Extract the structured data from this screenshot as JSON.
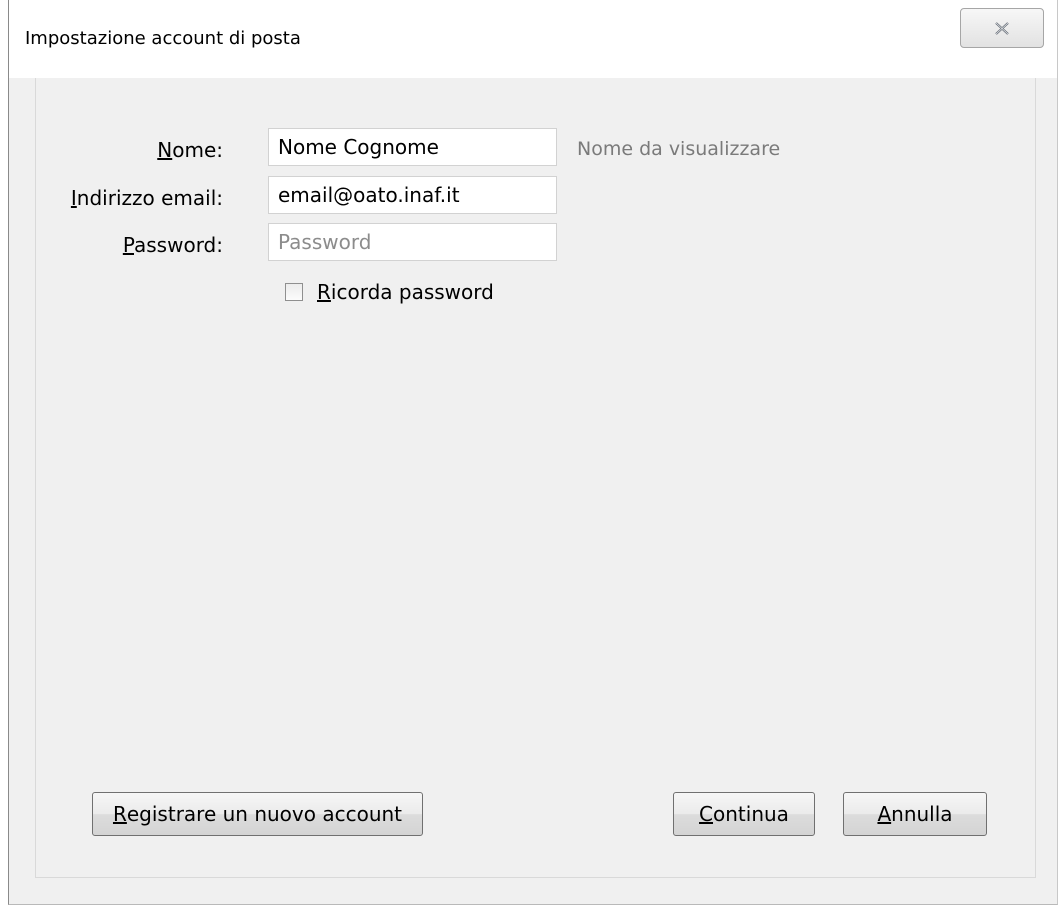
{
  "window": {
    "title": "Impostazione account di posta",
    "close_icon": "close-icon"
  },
  "form": {
    "name": {
      "label_key": "N",
      "label_rest": "ome:",
      "value": "Nome Cognome",
      "hint": "Nome da visualizzare"
    },
    "email": {
      "label_key": "I",
      "label_rest": "ndirizzo email:",
      "value": "email@oato.inaf.it"
    },
    "password": {
      "label_key": "P",
      "label_rest": "assword:",
      "value": "",
      "placeholder": "Password"
    },
    "remember": {
      "label_key": "R",
      "label_rest": "icorda password",
      "checked": false
    }
  },
  "buttons": {
    "register": {
      "key": "R",
      "rest": "egistrare un nuovo account"
    },
    "continue": {
      "key": "C",
      "rest": "ontinua"
    },
    "cancel": {
      "key": "A",
      "rest": "nnulla"
    }
  },
  "colors": {
    "dialog_background": "#f0f0f0",
    "hint_text": "#7a7a7a",
    "placeholder_text": "#8c8c8c"
  }
}
